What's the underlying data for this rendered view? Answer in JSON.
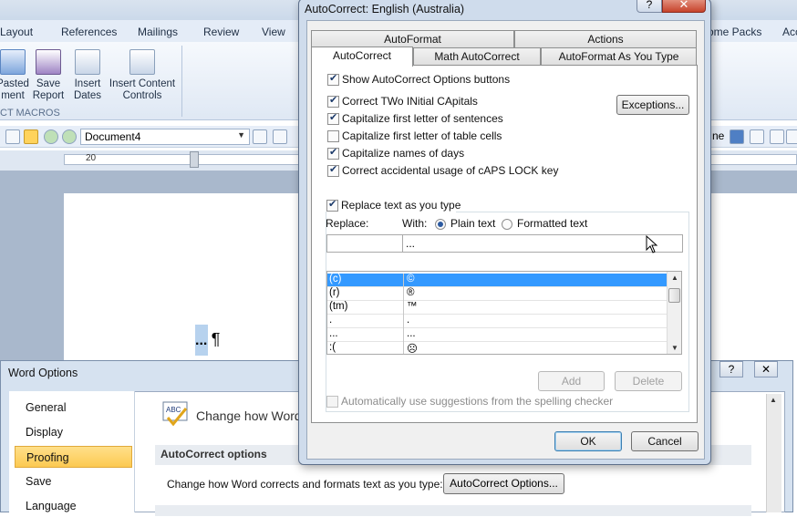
{
  "word": {
    "ribbon_tabs": [
      "Layout",
      "References",
      "Mailings",
      "Review",
      "View",
      "ome Packs",
      "Acc"
    ],
    "ribbon_buttons": [
      {
        "line1": "Pasted",
        "line2": "ment"
      },
      {
        "line1": "Save",
        "line2": "Report"
      },
      {
        "line1": "Insert",
        "line2": "Dates"
      },
      {
        "line1": "Insert Content",
        "line2": "Controls"
      }
    ],
    "group_label": "CT MACROS",
    "document_combo": "Document4",
    "quick_access_right_label": "ne",
    "ruler_number": "20",
    "paragraph_text": "...",
    "paragraph_mark": "¶"
  },
  "word_options": {
    "title": "Word Options",
    "help_glyph": "?",
    "close_glyph": "✕",
    "nav": [
      "General",
      "Display",
      "Proofing",
      "Save",
      "Language"
    ],
    "selected_nav": "Proofing",
    "main_title": "Change how Word",
    "section_header": "AutoCorrect options",
    "autocorrect_prompt": "Change how Word corrects and formats text as you type:",
    "autocorrect_button": "AutoCorrect Options..."
  },
  "autocorrect": {
    "title": "AutoCorrect: English (Australia)",
    "help_glyph": "?",
    "close_glyph": "✕",
    "tabs_row1": [
      "AutoFormat",
      "Actions"
    ],
    "tabs_row2": [
      "AutoCorrect",
      "Math AutoCorrect",
      "AutoFormat As You Type"
    ],
    "active_tab": "AutoCorrect",
    "options": [
      {
        "label": "Show AutoCorrect Options buttons",
        "checked": true
      },
      {
        "label": "Correct TWo INitial CApitals",
        "checked": true
      },
      {
        "label": "Capitalize first letter of sentences",
        "checked": true
      },
      {
        "label": "Capitalize first letter of table cells",
        "checked": false
      },
      {
        "label": "Capitalize names of days",
        "checked": true
      },
      {
        "label": "Correct accidental usage of cAPS LOCK key",
        "checked": true
      }
    ],
    "exceptions_button": "Exceptions...",
    "replace_as_you_type": {
      "label": "Replace text as you type",
      "checked": true
    },
    "replace_label": "Replace:",
    "with_label": "With:",
    "radio_plain": "Plain text",
    "radio_formatted": "Formatted text",
    "plain_selected": true,
    "replace_value": "",
    "with_value": "...",
    "list": [
      {
        "from": "(c)",
        "to": "©",
        "selected": true
      },
      {
        "from": "(r)",
        "to": "®",
        "selected": false
      },
      {
        "from": "(tm)",
        "to": "™",
        "selected": false
      },
      {
        "from": ".",
        "to": ".",
        "selected": false
      },
      {
        "from": "...",
        "to": "...",
        "selected": false
      },
      {
        "from": ":(",
        "to": "☹",
        "selected": false
      }
    ],
    "add_button": "Add",
    "delete_button": "Delete",
    "auto_suggest": {
      "label": "Automatically use suggestions from the spelling checker",
      "checked": false,
      "disabled": true
    },
    "ok_button": "OK",
    "cancel_button": "Cancel"
  }
}
